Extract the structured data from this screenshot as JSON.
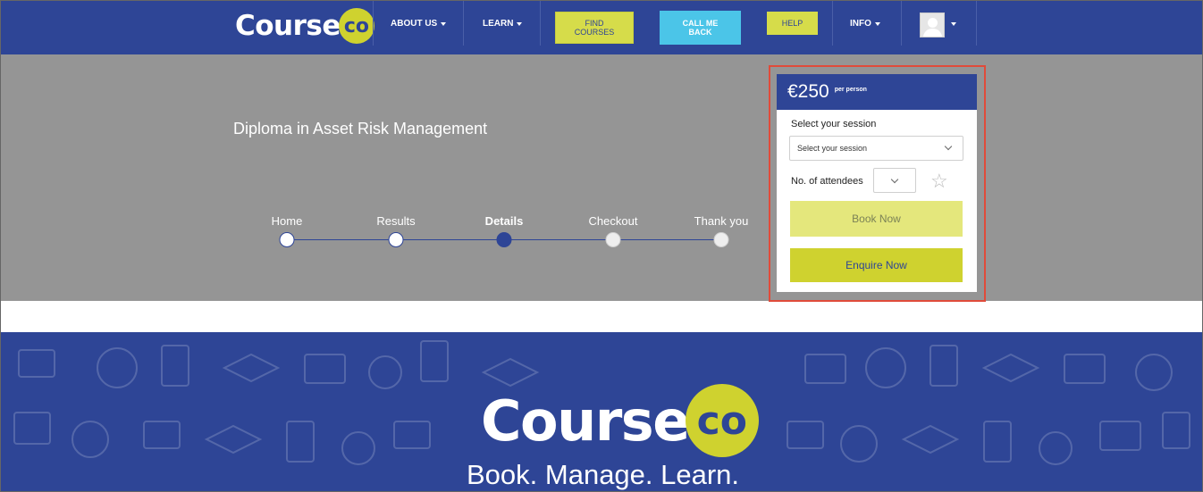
{
  "nav": {
    "logo_text": "Course",
    "logo_badge": "co",
    "about_us": "ABOUT US",
    "learn": "LEARN",
    "find_courses_1": "FIND",
    "find_courses_2": "COURSES",
    "call_me_back_1": "CALL ME",
    "call_me_back_2": "BACK",
    "help": "HELP",
    "info": "INFO"
  },
  "hero": {
    "course_title": "Diploma in Asset Risk Management",
    "steps": [
      {
        "label": "Home",
        "state": "done"
      },
      {
        "label": "Results",
        "state": "done"
      },
      {
        "label": "Details",
        "state": "active"
      },
      {
        "label": "Checkout",
        "state": "future"
      },
      {
        "label": "Thank you",
        "state": "future"
      }
    ]
  },
  "booking": {
    "price": "€250",
    "per_person": "per person",
    "session_label": "Select your session",
    "session_select_value": "Select your session",
    "attendees_label": "No. of attendees",
    "book_now": "Book Now",
    "enquire_now": "Enquire Now"
  },
  "footer": {
    "logo_text": "Course",
    "logo_badge": "co",
    "tagline": "Book. Manage. Learn."
  },
  "colors": {
    "brand_blue": "#2e4596",
    "brand_lime": "#cfd22f",
    "call_blue": "#4bc5e8",
    "highlight_red": "#e04b3a"
  }
}
